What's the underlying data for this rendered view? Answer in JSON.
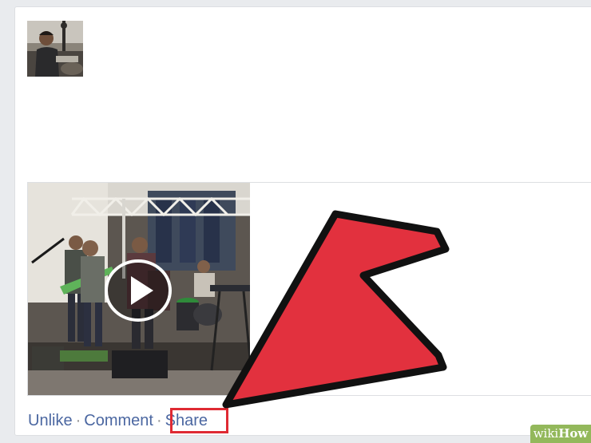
{
  "post": {
    "avatar_alt": "profile photo",
    "video_alt": "band performing video thumbnail"
  },
  "actions": {
    "unlike_label": "Unlike",
    "comment_label": "Comment",
    "share_label": "Share",
    "separator": "·"
  },
  "watermark": {
    "part1": "wiki",
    "part2": "How"
  },
  "colors": {
    "link": "#4b67a1",
    "highlight": "#df2a33",
    "arrow_fill": "#e2313e",
    "badge": "#93b85b"
  },
  "icons": {
    "play": "play-icon",
    "arrow": "pointer-arrow-icon"
  }
}
